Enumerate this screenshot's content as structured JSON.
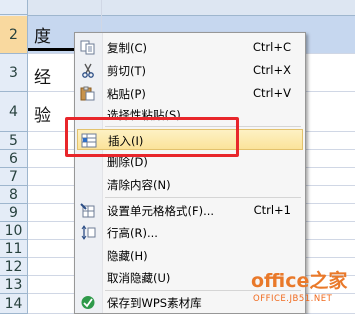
{
  "sheet": {
    "rows": [
      {
        "num": "",
        "text": ""
      },
      {
        "num": "2",
        "text": "度"
      },
      {
        "num": "3",
        "text": "经"
      },
      {
        "num": "4",
        "text": "验"
      },
      {
        "num": "5",
        "text": ""
      },
      {
        "num": "6",
        "text": ""
      },
      {
        "num": "7",
        "text": ""
      },
      {
        "num": "8",
        "text": ""
      },
      {
        "num": "9",
        "text": ""
      },
      {
        "num": "10",
        "text": ""
      },
      {
        "num": "11",
        "text": ""
      },
      {
        "num": "12",
        "text": ""
      },
      {
        "num": "13",
        "text": ""
      },
      {
        "num": "14",
        "text": ""
      }
    ]
  },
  "menu": {
    "items": [
      {
        "label": "复制(C)",
        "shortcut": "Ctrl+C",
        "icon": "copy-icon"
      },
      {
        "label": "剪切(T)",
        "shortcut": "Ctrl+X",
        "icon": "scissors-icon"
      },
      {
        "label": "粘贴(P)",
        "shortcut": "Ctrl+V",
        "icon": "paste-icon"
      },
      {
        "label": "选择性粘贴(S)...",
        "shortcut": "",
        "icon": ""
      },
      {
        "label": "插入(I)",
        "shortcut": "",
        "icon": "insert-rows-icon"
      },
      {
        "label": "删除(D)",
        "shortcut": "",
        "icon": ""
      },
      {
        "label": "清除内容(N)",
        "shortcut": "",
        "icon": ""
      },
      {
        "label": "设置单元格格式(F)...",
        "shortcut": "Ctrl+1",
        "icon": "format-cells-icon"
      },
      {
        "label": "行高(R)...",
        "shortcut": "",
        "icon": "row-height-icon"
      },
      {
        "label": "隐藏(H)",
        "shortcut": "",
        "icon": ""
      },
      {
        "label": "取消隐藏(U)",
        "shortcut": "",
        "icon": ""
      },
      {
        "label": "保存到WPS素材库",
        "shortcut": "",
        "icon": "wps-library-icon"
      }
    ],
    "highlighted": "插入(I)"
  },
  "watermark": {
    "main": "office之家",
    "sub": "OFFICE.JB51.NET"
  },
  "colors": {
    "highlight_box": "#e8262b",
    "selected_row": "#c6d7ef",
    "watermark": "#e9792a"
  }
}
